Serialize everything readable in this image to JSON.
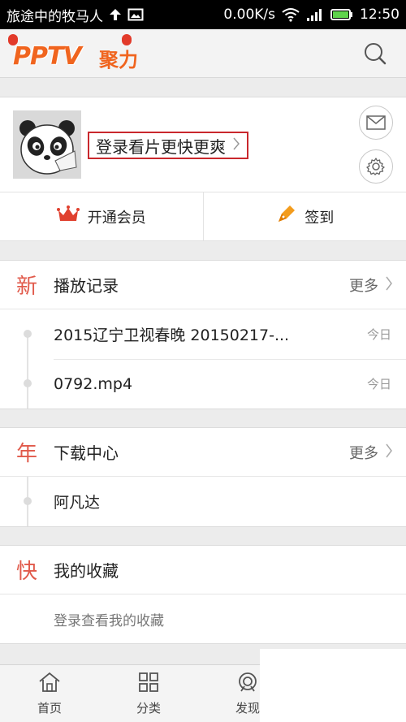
{
  "status_bar": {
    "notification_text": "旅途中的牧马人",
    "network_speed": "0.00K/s",
    "time": "12:50",
    "icons": [
      "upload-arrow-icon",
      "image-icon",
      "wifi-icon",
      "signal-icon",
      "battery-icon"
    ]
  },
  "header": {
    "logo_text": "PPTV",
    "logo_tag": "聚力",
    "search_icon": "search-icon"
  },
  "profile": {
    "login_prompt": "登录看片更快更爽",
    "message_icon": "mail-icon",
    "settings_icon": "gear-icon",
    "avatar": "panda-avatar"
  },
  "actions": {
    "vip_label": "开通会员",
    "vip_icon": "crown-icon",
    "checkin_label": "签到",
    "checkin_icon": "pen-icon"
  },
  "history": {
    "badge": "新",
    "title": "播放记录",
    "more": "更多",
    "items": [
      {
        "title": "2015辽宁卫视春晚 20150217-...",
        "date": "今日"
      },
      {
        "title": "0792.mp4",
        "date": "今日"
      }
    ]
  },
  "downloads": {
    "badge": "年",
    "title": "下载中心",
    "more": "更多",
    "items": [
      {
        "title": "阿凡达"
      }
    ]
  },
  "favorites": {
    "badge": "快",
    "title": "我的收藏",
    "empty_text": "登录查看我的收藏"
  },
  "bottom_nav": {
    "items": [
      {
        "label": "首页",
        "icon": "home-icon"
      },
      {
        "label": "分类",
        "icon": "grid-icon"
      },
      {
        "label": "发现",
        "icon": "discover-icon"
      }
    ]
  },
  "colors": {
    "accent_red": "#c9282d",
    "badge_red": "#e15a4b",
    "logo_orange": "#f0641e",
    "crown_red": "#e0412f",
    "checkin_orange": "#f39c1d"
  }
}
